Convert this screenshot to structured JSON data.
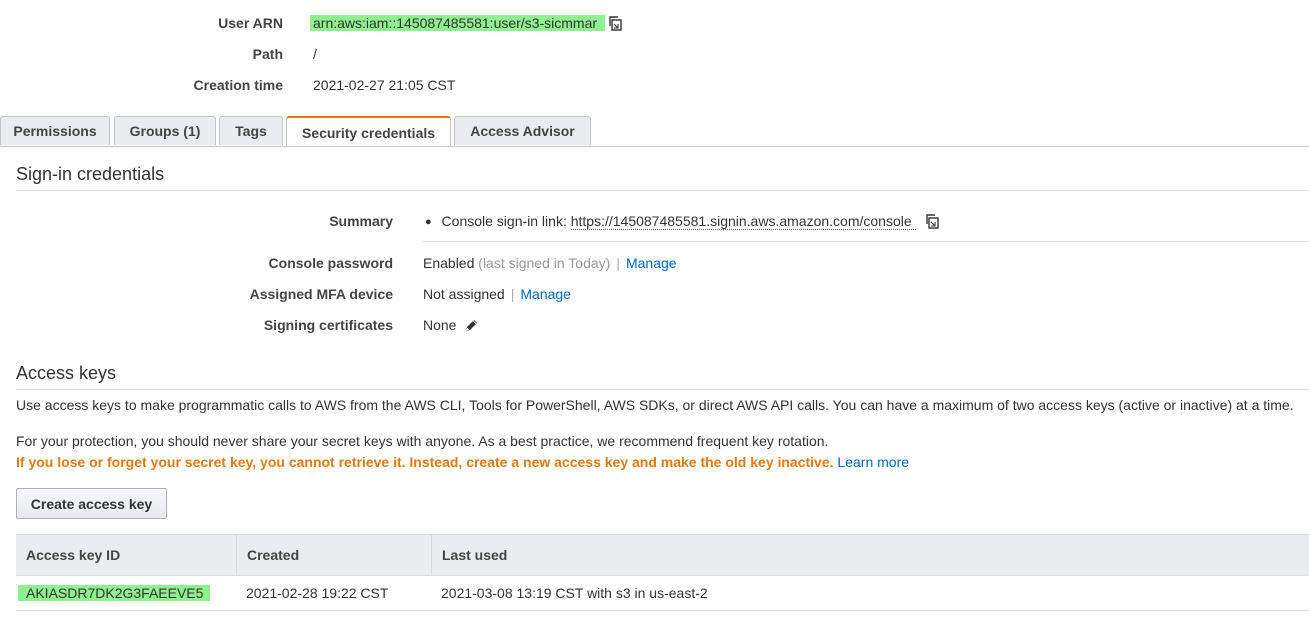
{
  "summary": {
    "user_arn_label": "User ARN",
    "user_arn_value": "arn:aws:iam::145087485581:user/s3-sicmmar",
    "path_label": "Path",
    "path_value": "/",
    "creation_label": "Creation time",
    "creation_value": "2021-02-27 21:05 CST"
  },
  "tabs": [
    {
      "label": "Permissions"
    },
    {
      "label": "Groups (1)"
    },
    {
      "label": "Tags"
    },
    {
      "label": "Security credentials",
      "active": true
    },
    {
      "label": "Access Advisor"
    }
  ],
  "signin": {
    "title": "Sign-in credentials",
    "summary_label": "Summary",
    "console_link_prefix": "Console sign-in link:",
    "console_link_url": "https://145087485581.signin.aws.amazon.com/console",
    "password_label": "Console password",
    "password_status": "Enabled",
    "password_note": "(last signed in Today)",
    "password_manage": "Manage",
    "mfa_label": "Assigned MFA device",
    "mfa_status": "Not assigned",
    "mfa_manage": "Manage",
    "certs_label": "Signing certificates",
    "certs_value": "None",
    "separator": "|"
  },
  "access_keys": {
    "title": "Access keys",
    "description": "Use access keys to make programmatic calls to AWS from the AWS CLI, Tools for PowerShell, AWS SDKs, or direct AWS API calls. You can have a maximum of two access keys (active or inactive) at a time.",
    "protection_note": "For your protection, you should never share your secret keys with anyone. As a best practice, we recommend frequent key rotation.",
    "warning": "If you lose or forget your secret key, you cannot retrieve it. Instead, create a new access key and make the old key inactive.",
    "learn_more": "Learn more",
    "create_button": "Create access key",
    "columns": [
      "Access key ID",
      "Created",
      "Last used"
    ],
    "rows": [
      {
        "id": "AKIASDR7DK2G3FAEEVE5",
        "created": "2021-02-28 19:22 CST",
        "last_used": "2021-03-08 13:19 CST with s3 in us-east-2"
      }
    ]
  },
  "colors": {
    "highlight": "#8ef08e",
    "link": "#0066c0",
    "warning": "#e47911",
    "active_tab_accent": "#e47911"
  },
  "icons": [
    "copy-icon",
    "pencil-icon",
    "bullet-icon"
  ]
}
